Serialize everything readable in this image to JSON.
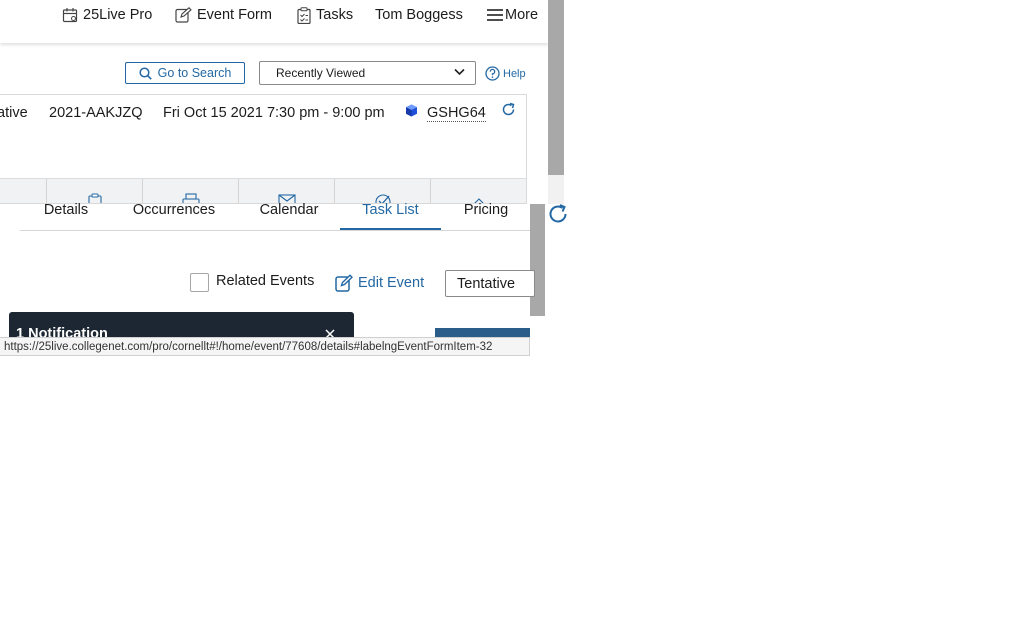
{
  "nav": {
    "pro_label": "25Live Pro",
    "event_form_label": "Event Form",
    "tasks_label": "Tasks",
    "user_name": "Tom Boggess",
    "more_label": "More"
  },
  "search": {
    "go_to_search_label": "Go to Search",
    "recent_value": "Recently Viewed",
    "help_label": "Help"
  },
  "event": {
    "state_partial": "ative",
    "reference": "2021-AAKJZQ",
    "datetime": "Fri Oct 15 2021 7:30 pm - 9:00 pm",
    "locator": "GSHG64"
  },
  "tabs": [
    {
      "label": "Details",
      "active": false
    },
    {
      "label": "Occurrences",
      "active": false
    },
    {
      "label": "Calendar",
      "active": false
    },
    {
      "label": "Task List",
      "active": true
    },
    {
      "label": "Pricing",
      "active": false
    }
  ],
  "actions": {
    "related_events_label": "Related Events",
    "related_events_checked": false,
    "edit_event_label": "Edit Event",
    "state_value": "Tentative"
  },
  "notification": {
    "title": "1 Notification"
  },
  "status_url": "https://25live.collegenet.com/pro/cornellt#!/home/event/77608/details#labelngEventFormItem-32",
  "colors": {
    "accent": "#2368a4",
    "toast_bg": "#1c2733"
  },
  "icons": {
    "pro": "calendar-icon",
    "event_form": "edit-icon",
    "tasks": "clipboard-icon",
    "more": "hamburger-icon",
    "search": "search-icon",
    "help": "help-icon",
    "locator": "cube-icon",
    "refresh": "refresh-icon",
    "close": "close-icon"
  }
}
